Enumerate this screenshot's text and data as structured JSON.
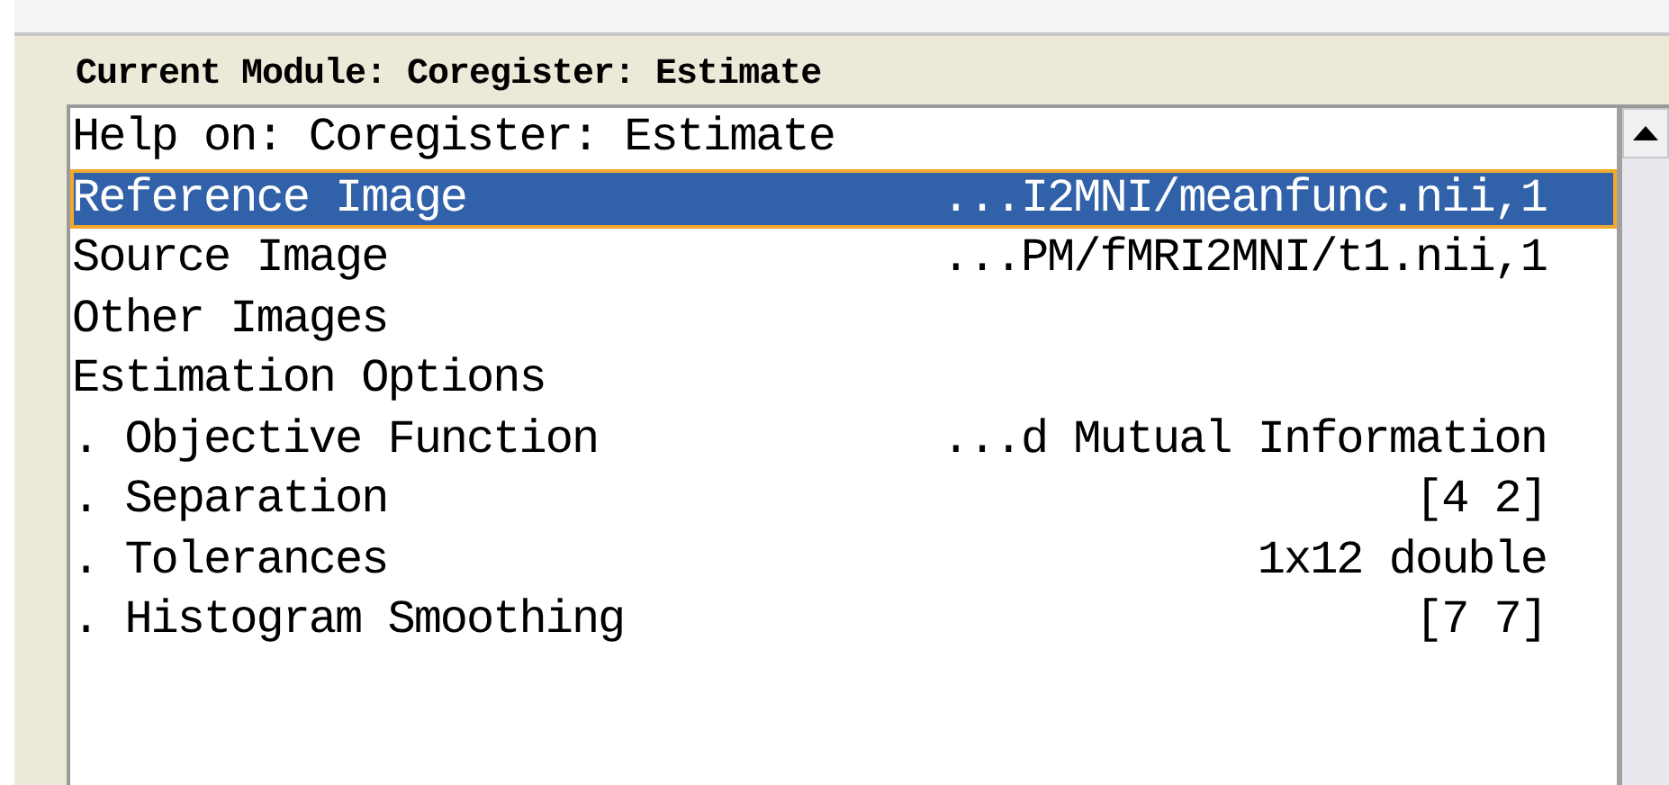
{
  "module_title": "Current Module: Coregister: Estimate",
  "items": [
    {
      "label": "Help on: Coregister: Estimate",
      "selected": false
    },
    {
      "label": "Reference Image",
      "value": "...I2MNI/meanfunc.nii,1",
      "selected": true
    },
    {
      "label": "Source Image",
      "value": "...PM/fMRI2MNI/t1.nii,1",
      "selected": false
    },
    {
      "label": "Other Images",
      "selected": false
    },
    {
      "label": "Estimation Options",
      "selected": false
    },
    {
      "label": ". Objective Function",
      "value": "...d Mutual Information",
      "selected": false
    },
    {
      "label": ". Separation",
      "value": "[4 2]",
      "selected": false
    },
    {
      "label": ". Tolerances",
      "value": "1x12 double",
      "selected": false
    },
    {
      "label": ". Histogram Smoothing",
      "value": "[7 7]",
      "selected": false
    }
  ]
}
